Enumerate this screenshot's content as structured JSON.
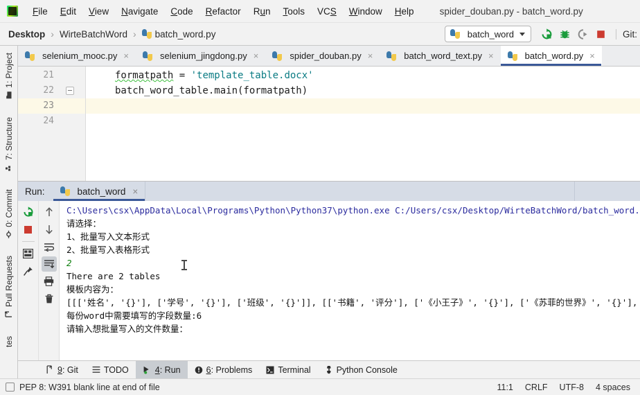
{
  "window": {
    "title": "spider_douban.py - batch_word.py",
    "logo": "pycharm-logo"
  },
  "menubar": {
    "items": [
      {
        "label": "File"
      },
      {
        "label": "Edit"
      },
      {
        "label": "View"
      },
      {
        "label": "Navigate"
      },
      {
        "label": "Code"
      },
      {
        "label": "Refactor"
      },
      {
        "label": "Run"
      },
      {
        "label": "Tools"
      },
      {
        "label": "VCS"
      },
      {
        "label": "Window"
      },
      {
        "label": "Help"
      }
    ]
  },
  "navbar": {
    "breadcrumbs": [
      {
        "label": "Desktop",
        "bold": true
      },
      {
        "label": "WirteBatchWord",
        "bold": false
      },
      {
        "label": "batch_word.py",
        "bold": false,
        "icon": "python-file-icon"
      }
    ],
    "separator": "›",
    "run_config": {
      "label": "batch_word",
      "icon": "python-config-icon"
    },
    "toolbar_icons": [
      "rerun-icon",
      "debug-icon",
      "run-with-coverage-icon",
      "stop-icon"
    ],
    "git_label": "Git:"
  },
  "left_strip": {
    "items": [
      {
        "label": "1: Project",
        "icon": "project-folder-icon"
      },
      {
        "label": "7: Structure",
        "icon": "structure-icon"
      },
      {
        "label": "0: Commit",
        "icon": "commit-icon"
      },
      {
        "label": "Pull Requests",
        "icon": "pull-request-icon"
      },
      {
        "label": "tes",
        "icon": ""
      }
    ]
  },
  "editor_tabs": [
    {
      "label": "selenium_mooc.py",
      "active": false
    },
    {
      "label": "selenium_jingdong.py",
      "active": false
    },
    {
      "label": "spider_douban.py",
      "active": false
    },
    {
      "label": "batch_word_text.py",
      "active": false
    },
    {
      "label": "batch_word.py",
      "active": true
    }
  ],
  "editor": {
    "lines": [
      {
        "num": "21",
        "current": false,
        "fold": false,
        "segments": [
          {
            "text": "formatpath",
            "style": "wavy"
          },
          {
            "text": " = ",
            "style": "op"
          },
          {
            "text": "'template_table.docx'",
            "style": "str2"
          }
        ]
      },
      {
        "num": "22",
        "current": false,
        "fold": true,
        "segments": [
          {
            "text": "batch_word_table.main(formatpath)",
            "style": "plain"
          }
        ]
      },
      {
        "num": "23",
        "current": true,
        "fold": false,
        "segments": []
      },
      {
        "num": "24",
        "current": false,
        "fold": false,
        "segments": []
      }
    ]
  },
  "run_window": {
    "label": "Run:",
    "tab": {
      "label": "batch_word",
      "icon": "python-config-icon",
      "close": "×"
    },
    "toolbar_left": [
      "rerun-icon",
      "stop-icon",
      "layout-icon",
      "pin-icon"
    ],
    "toolbar_right": [
      "scroll-up-icon",
      "scroll-down-icon",
      "soft-wrap-icon",
      "scroll-to-end-icon",
      "print-icon",
      "trash-icon"
    ],
    "console": [
      {
        "text": "C:\\Users\\csx\\AppData\\Local\\Programs\\Python\\Python37\\python.exe C:/Users/csx/Desktop/WirteBatchWord/batch_word.py",
        "style": "cmd"
      },
      {
        "text": "请选择：",
        "style": "out"
      },
      {
        "text": "1、批量写入文本形式",
        "style": "out"
      },
      {
        "text": "2、批量写入表格形式",
        "style": "out"
      },
      {
        "text": "2",
        "style": "in"
      },
      {
        "text": "There are 2 tables",
        "style": "out"
      },
      {
        "text": "模板内容为：",
        "style": "out"
      },
      {
        "text": "[[['姓名', '{}'], ['学号', '{}'], ['班级', '{}']], [['书籍', '评分'], ['《小王子》', '{}'], ['《苏菲的世界》', '{}'], ['《平",
        "style": "out"
      },
      {
        "text": "每份word中需要填写的字段数量:6",
        "style": "out"
      },
      {
        "text": "请输入想批量写入的文件数量：",
        "style": "out"
      }
    ]
  },
  "bottom_bar": {
    "tabs": [
      {
        "label": "9: Git",
        "icon": "git-branch-icon",
        "active": false
      },
      {
        "label": "TODO",
        "icon": "todo-icon",
        "active": false
      },
      {
        "label": "4: Run",
        "icon": "run-play-icon",
        "active": true
      },
      {
        "label": "6: Problems",
        "icon": "problems-icon",
        "active": false
      },
      {
        "label": "Terminal",
        "icon": "terminal-icon",
        "active": false
      },
      {
        "label": "Python Console",
        "icon": "python-console-icon",
        "active": false
      }
    ]
  },
  "status_bar": {
    "message": "PEP 8: W391 blank line at end of file",
    "caret_position": "11:1",
    "line_separator": "CRLF",
    "encoding": "UTF-8",
    "indent": "4 spaces"
  },
  "colors": {
    "accent_blue": "#3b5998",
    "console_command": "#2b2b9e",
    "console_input": "#0b7d0b",
    "string_literal": "#0a7b83",
    "current_line": "#fdf9e7",
    "run_panel_header": "#d6dce6"
  }
}
